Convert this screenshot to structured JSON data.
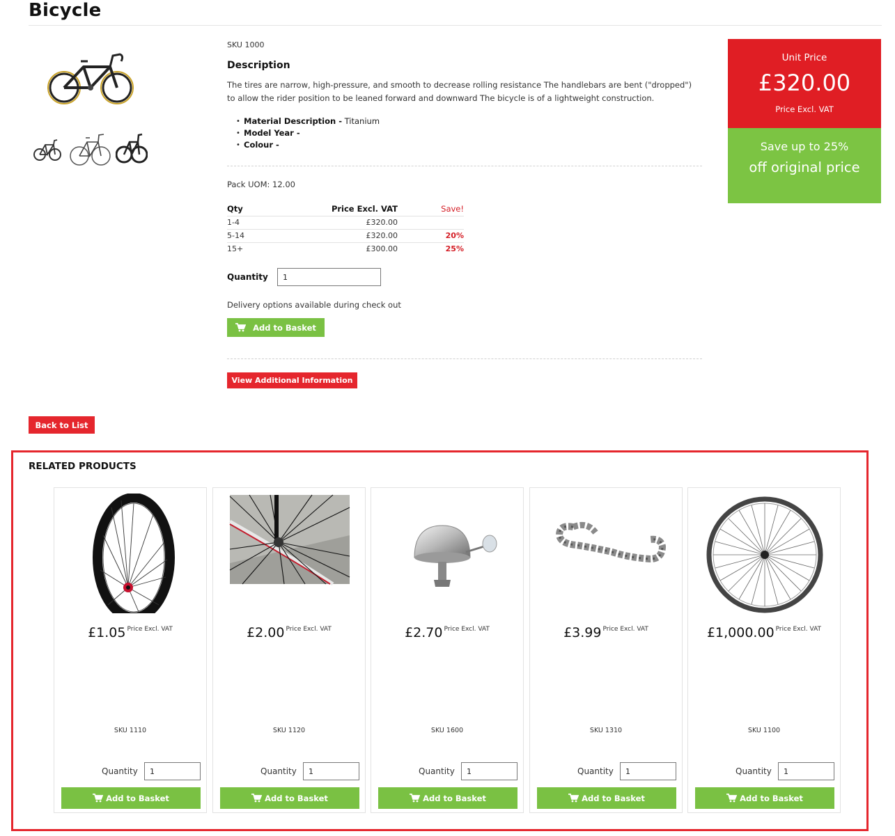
{
  "product": {
    "title": "Bicycle",
    "sku": "SKU 1000",
    "description_heading": "Description",
    "description": "The tires are narrow, high-pressure, and smooth to decrease rolling resistance The handlebars are bent (\"dropped\") to allow the rider position to be leaned forward and downward The bicycle is of a lightweight construction.",
    "attributes": [
      {
        "label": "Material Description -",
        "value": " Titanium"
      },
      {
        "label": "Model Year -",
        "value": ""
      },
      {
        "label": "Colour -",
        "value": ""
      }
    ],
    "pack_uom": "Pack UOM: 12.00"
  },
  "price_table": {
    "headers": {
      "qty": "Qty",
      "price": "Price Excl. VAT",
      "save": "Save!"
    },
    "rows": [
      {
        "qty": "1-4",
        "price": "£320.00",
        "save": ""
      },
      {
        "qty": "5-14",
        "price": "£320.00",
        "save": "20%"
      },
      {
        "qty": "15+",
        "price": "£300.00",
        "save": "25%"
      }
    ]
  },
  "purchase": {
    "quantity_label": "Quantity",
    "quantity_value": "1",
    "delivery_text": "Delivery options available during check out",
    "add_button": "Add to Basket",
    "view_info_button": "View Additional Information",
    "back_button": "Back to List"
  },
  "price_box": {
    "label": "Unit Price",
    "value": "£320.00",
    "vat": "Price Excl. VAT",
    "save_line1": "Save up to 25%",
    "save_line2": "off original price"
  },
  "colors": {
    "red": "#e5262d",
    "green": "#7ac143"
  },
  "related": {
    "title": "RELATED PRODUCTS",
    "items": [
      {
        "price": "£1.05",
        "vat": "Price Excl. VAT",
        "sku": "SKU 1110",
        "quantity_label": "Quantity",
        "quantity_value": "1",
        "button": "Add to Basket",
        "image": "carbon-wheel"
      },
      {
        "price": "£2.00",
        "vat": "Price Excl. VAT",
        "sku": "SKU 1120",
        "quantity_label": "Quantity",
        "quantity_value": "1",
        "button": "Add to Basket",
        "image": "wheel-spokes-photo"
      },
      {
        "price": "£2.70",
        "vat": "Price Excl. VAT",
        "sku": "SKU 1600",
        "quantity_label": "Quantity",
        "quantity_value": "1",
        "button": "Add to Basket",
        "image": "bike-bell"
      },
      {
        "price": "£3.99",
        "vat": "Price Excl. VAT",
        "sku": "SKU 1310",
        "quantity_label": "Quantity",
        "quantity_value": "1",
        "button": "Add to Basket",
        "image": "bike-chain"
      },
      {
        "price": "£1,000.00",
        "vat": "Price Excl. VAT",
        "sku": "SKU 1100",
        "quantity_label": "Quantity",
        "quantity_value": "1",
        "button": "Add to Basket",
        "image": "spoked-wheel"
      }
    ]
  }
}
